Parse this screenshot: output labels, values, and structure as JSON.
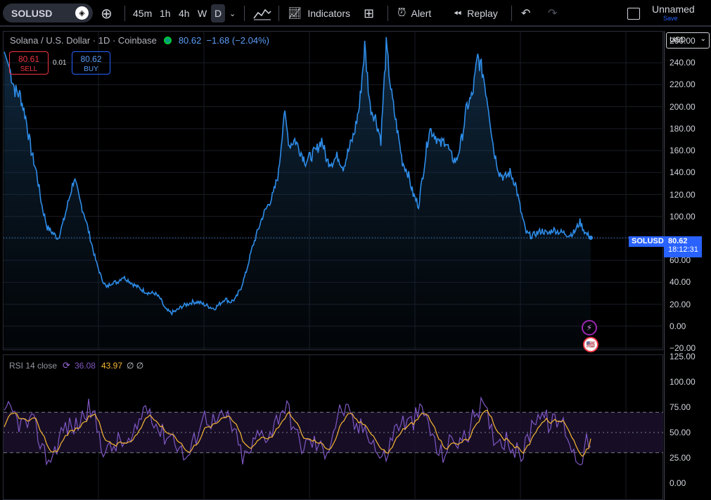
{
  "toolbar": {
    "symbol": "SOLUSD",
    "timeframes": [
      "45m",
      "1h",
      "4h",
      "W",
      "D"
    ],
    "active_timeframe": "D",
    "indicators_label": "Indicators",
    "alert_label": "Alert",
    "replay_label": "Replay",
    "layout_name": "Unnamed",
    "save_label": "Save"
  },
  "legend": {
    "title": "Solana / U.S. Dollar · 1D · Coinbase",
    "price": "80.62",
    "change": "−1.68 (−2.04%)"
  },
  "trade": {
    "sell_price": "80.61",
    "sell_label": "SELL",
    "spread": "0.01",
    "buy_price": "80.62",
    "buy_label": "BUY"
  },
  "price_tag": {
    "symbol": "SOLUSD",
    "price": "80.62",
    "countdown": "18:12:31"
  },
  "currency": "USD",
  "rsi_legend": {
    "label": "RSI 14 close",
    "rsi": "36.08",
    "ma": "43.97",
    "extra": "∅ ∅"
  },
  "price_axis": [
    "260.00",
    "240.00",
    "220.00",
    "200.00",
    "180.00",
    "160.00",
    "140.00",
    "120.00",
    "100.00",
    "60.00",
    "40.00",
    "20.00",
    "0.00",
    "−20.00"
  ],
  "rsi_axis": [
    "125.00",
    "100.00",
    "75.00",
    "50.00",
    "25.00",
    "0.00"
  ],
  "colors": {
    "line": "#2e8ce8",
    "rsi": "#7e57c2",
    "rsi_ma": "#f7b733",
    "accent": "#2962ff"
  },
  "chart_data": {
    "type": "line",
    "series": [
      {
        "name": "SOLUSD",
        "values": [
          250,
          235,
          215,
          210,
          190,
          160,
          140,
          110,
          90,
          85,
          80,
          95,
          115,
          135,
          115,
          100,
          80,
          60,
          45,
          35,
          40,
          40,
          45,
          42,
          38,
          35,
          32,
          30,
          30,
          25,
          15,
          12,
          14,
          18,
          20,
          22,
          22,
          20,
          18,
          16,
          20,
          25,
          22,
          25,
          35,
          50,
          70,
          85,
          100,
          110,
          120,
          140,
          195,
          165,
          170,
          160,
          150,
          155,
          160,
          170,
          150,
          150,
          155,
          145,
          160,
          175,
          200,
          255,
          200,
          190,
          170,
          255,
          210,
          180,
          150,
          140,
          120,
          110,
          145,
          180,
          175,
          165,
          170,
          155,
          150,
          170,
          200,
          210,
          245,
          230,
          200,
          160,
          140,
          135,
          140,
          130,
          105,
          85,
          82,
          85,
          87,
          84,
          88,
          86,
          85,
          83,
          86,
          95,
          85,
          80.62
        ],
        "y_range": [
          -20,
          260
        ]
      }
    ],
    "rsi": {
      "levels": [
        30,
        50,
        70
      ],
      "y_range": [
        0,
        125
      ],
      "last": 36.08,
      "ma_last": 43.97
    }
  }
}
